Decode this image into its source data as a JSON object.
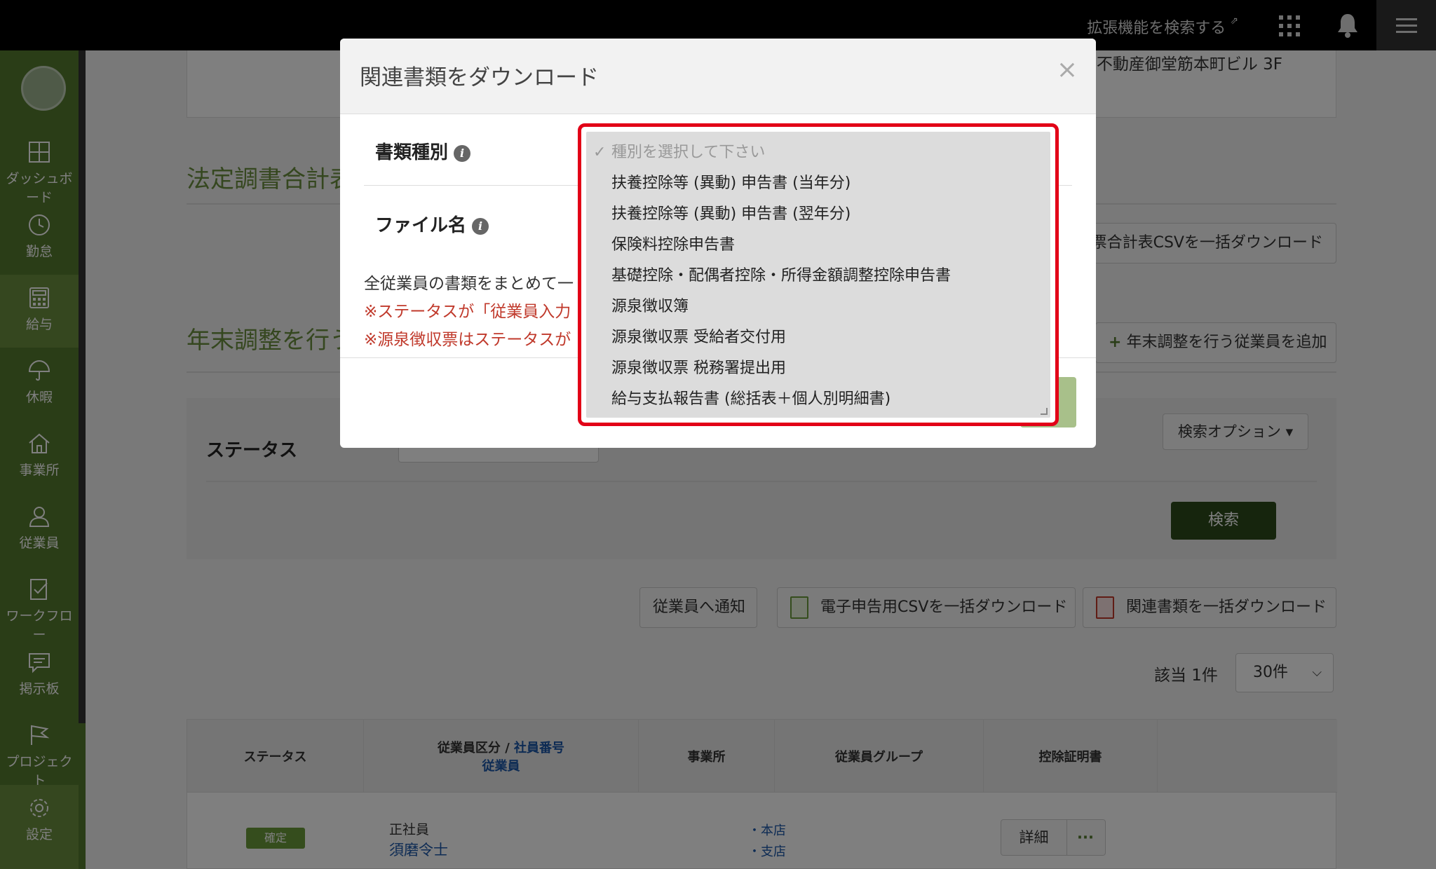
{
  "topbar": {
    "ext_link": "拡張機能を検索する",
    "ext_icon": "external-link-icon",
    "apps_icon": "grid-icon",
    "bell_icon": "bell-icon",
    "menu_icon": "hamburger-icon"
  },
  "sidebar": {
    "items": [
      {
        "label": "ダッシュボード",
        "icon": "dashboard-icon"
      },
      {
        "label": "勤怠",
        "icon": "clock-icon"
      },
      {
        "label": "給与",
        "icon": "calculator-icon"
      },
      {
        "label": "休暇",
        "icon": "umbrella-icon"
      },
      {
        "label": "事業所",
        "icon": "home-icon"
      },
      {
        "label": "従業員",
        "icon": "person-icon"
      },
      {
        "label": "ワークフロー",
        "icon": "workflow-icon"
      },
      {
        "label": "掲示板",
        "icon": "board-icon"
      },
      {
        "label": "プロジェクト",
        "icon": "flag-icon"
      },
      {
        "label": "設定",
        "icon": "gear-icon"
      }
    ]
  },
  "page": {
    "address": "不動産御堂筋本町ビル 3F",
    "section1_title": "法定調書合計表",
    "section1_button": "票合計表CSVを一括ダウンロード",
    "section2_title": "年末調整を行う",
    "add_employee_button": "年末調整を行う従業員を追加",
    "status_label": "ステータス",
    "search_options": "検索オプション",
    "search_button": "検索",
    "notify_button": "従業員へ通知",
    "csv_download_button": "電子申告用CSVを一括ダウンロード",
    "docs_download_button": "関連書類を一括ダウンロード",
    "count": "該当 1件",
    "per_page": "30件",
    "table": {
      "headers": {
        "status": "ステータス",
        "employee_category": "従業員区分",
        "slash": " / ",
        "employee_number": "社員番号",
        "employee": "従業員",
        "office": "事業所",
        "group": "従業員グループ",
        "certificate": "控除証明書"
      },
      "row": {
        "status": "確定",
        "category": "正社員",
        "name": "須磨令士",
        "office1": "・本店",
        "office2": "・支店",
        "detail": "詳細",
        "more": "···"
      }
    }
  },
  "modal": {
    "title": "関連書類をダウンロード",
    "close": "×",
    "doc_type_label": "書類種別",
    "file_name_label": "ファイル名",
    "description": "全従業員の書類をまとめて一",
    "note1": "※ステータスが「従業員入力",
    "note2": "※源泉徴収票はステータスが"
  },
  "dropdown": {
    "options": [
      "種別を選択して下さい",
      "扶養控除等 (異動) 申告書 (当年分)",
      "扶養控除等 (異動) 申告書 (翌年分)",
      "保険料控除申告書",
      "基礎控除・配偶者控除・所得金額調整控除申告書",
      "源泉徴収簿",
      "源泉徴収票 受給者交付用",
      "源泉徴収票 税務署提出用",
      "給与支払報告書 (総括表＋個人別明細書)"
    ],
    "selected_mark": "✓"
  },
  "colors": {
    "sidebar": "#557a2e",
    "accent_green": "#6a8e3f",
    "highlight_red": "#e20017",
    "link_blue": "#1a56a8",
    "note_red": "#c0392b"
  }
}
